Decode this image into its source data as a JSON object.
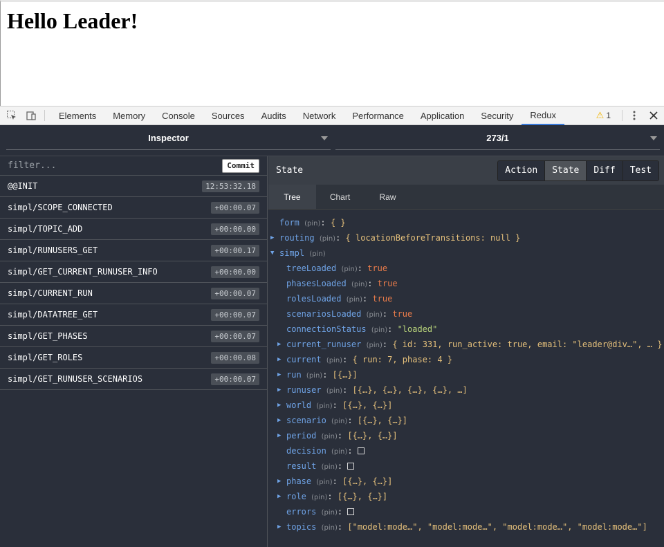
{
  "page": {
    "heading": "Hello Leader!"
  },
  "devtools": {
    "tabs": [
      "Elements",
      "Memory",
      "Console",
      "Sources",
      "Audits",
      "Network",
      "Performance",
      "Application",
      "Security",
      "Redux"
    ],
    "active_tab": "Redux",
    "warning_count": "1"
  },
  "redux": {
    "monitor_selector": "Inspector",
    "instance_selector": "273/1",
    "filter_placeholder": "filter...",
    "commit_label": "Commit",
    "actions": [
      {
        "name": "@@INIT",
        "time": "12:53:32.18"
      },
      {
        "name": "simpl/SCOPE_CONNECTED",
        "time": "+00:00.07"
      },
      {
        "name": "simpl/TOPIC_ADD",
        "time": "+00:00.00"
      },
      {
        "name": "simpl/RUNUSERS_GET",
        "time": "+00:00.17"
      },
      {
        "name": "simpl/GET_CURRENT_RUNUSER_INFO",
        "time": "+00:00.00"
      },
      {
        "name": "simpl/CURRENT_RUN",
        "time": "+00:00.07"
      },
      {
        "name": "simpl/DATATREE_GET",
        "time": "+00:00.07"
      },
      {
        "name": "simpl/GET_PHASES",
        "time": "+00:00.07"
      },
      {
        "name": "simpl/GET_ROLES",
        "time": "+00:00.08"
      },
      {
        "name": "simpl/GET_RUNUSER_SCENARIOS",
        "time": "+00:00.07"
      }
    ],
    "right_title": "State",
    "modes": [
      "Action",
      "State",
      "Diff",
      "Test"
    ],
    "active_mode": "State",
    "views": [
      "Tree",
      "Chart",
      "Raw"
    ],
    "active_view": "Tree",
    "pin_label": "(pin)",
    "tree": [
      {
        "key": "form",
        "value": "{ }",
        "type": "obj",
        "depth": 0,
        "expander": ""
      },
      {
        "key": "routing",
        "value": "{ locationBeforeTransitions: null }",
        "type": "obj",
        "depth": 0,
        "expander": "collapsed"
      },
      {
        "key": "simpl",
        "value": "",
        "type": "obj",
        "depth": 0,
        "expander": "expanded"
      },
      {
        "key": "treeLoaded",
        "value": "true",
        "type": "bool",
        "depth": 1,
        "expander": ""
      },
      {
        "key": "phasesLoaded",
        "value": "true",
        "type": "bool",
        "depth": 1,
        "expander": ""
      },
      {
        "key": "rolesLoaded",
        "value": "true",
        "type": "bool",
        "depth": 1,
        "expander": ""
      },
      {
        "key": "scenariosLoaded",
        "value": "true",
        "type": "bool",
        "depth": 1,
        "expander": ""
      },
      {
        "key": "connectionStatus",
        "value": "\"loaded\"",
        "type": "str",
        "depth": 1,
        "expander": ""
      },
      {
        "key": "current_runuser",
        "value": "{ id: 331, run_active: true, email: \"leader@div…\", … }",
        "type": "obj",
        "depth": 1,
        "expander": "collapsed"
      },
      {
        "key": "current",
        "value": "{ run: 7, phase: 4 }",
        "type": "obj",
        "depth": 1,
        "expander": "collapsed"
      },
      {
        "key": "run",
        "value": "[{…}]",
        "type": "obj",
        "depth": 1,
        "expander": "collapsed"
      },
      {
        "key": "runuser",
        "value": "[{…}, {…}, {…}, {…}, …]",
        "type": "obj",
        "depth": 1,
        "expander": "collapsed"
      },
      {
        "key": "world",
        "value": "[{…}, {…}]",
        "type": "obj",
        "depth": 1,
        "expander": "collapsed"
      },
      {
        "key": "scenario",
        "value": "[{…}, {…}]",
        "type": "obj",
        "depth": 1,
        "expander": "collapsed"
      },
      {
        "key": "period",
        "value": "[{…}, {…}]",
        "type": "obj",
        "depth": 1,
        "expander": "collapsed"
      },
      {
        "key": "decision",
        "value": "[]",
        "type": "empty",
        "depth": 1,
        "expander": ""
      },
      {
        "key": "result",
        "value": "[]",
        "type": "empty",
        "depth": 1,
        "expander": ""
      },
      {
        "key": "phase",
        "value": "[{…}, {…}]",
        "type": "obj",
        "depth": 1,
        "expander": "collapsed"
      },
      {
        "key": "role",
        "value": "[{…}, {…}]",
        "type": "obj",
        "depth": 1,
        "expander": "collapsed"
      },
      {
        "key": "errors",
        "value": "[]",
        "type": "empty",
        "depth": 1,
        "expander": ""
      },
      {
        "key": "topics",
        "value": "[\"model:mode…\", \"model:mode…\", \"model:mode…\", \"model:mode…\"]",
        "type": "obj",
        "depth": 1,
        "expander": "collapsed"
      }
    ]
  }
}
